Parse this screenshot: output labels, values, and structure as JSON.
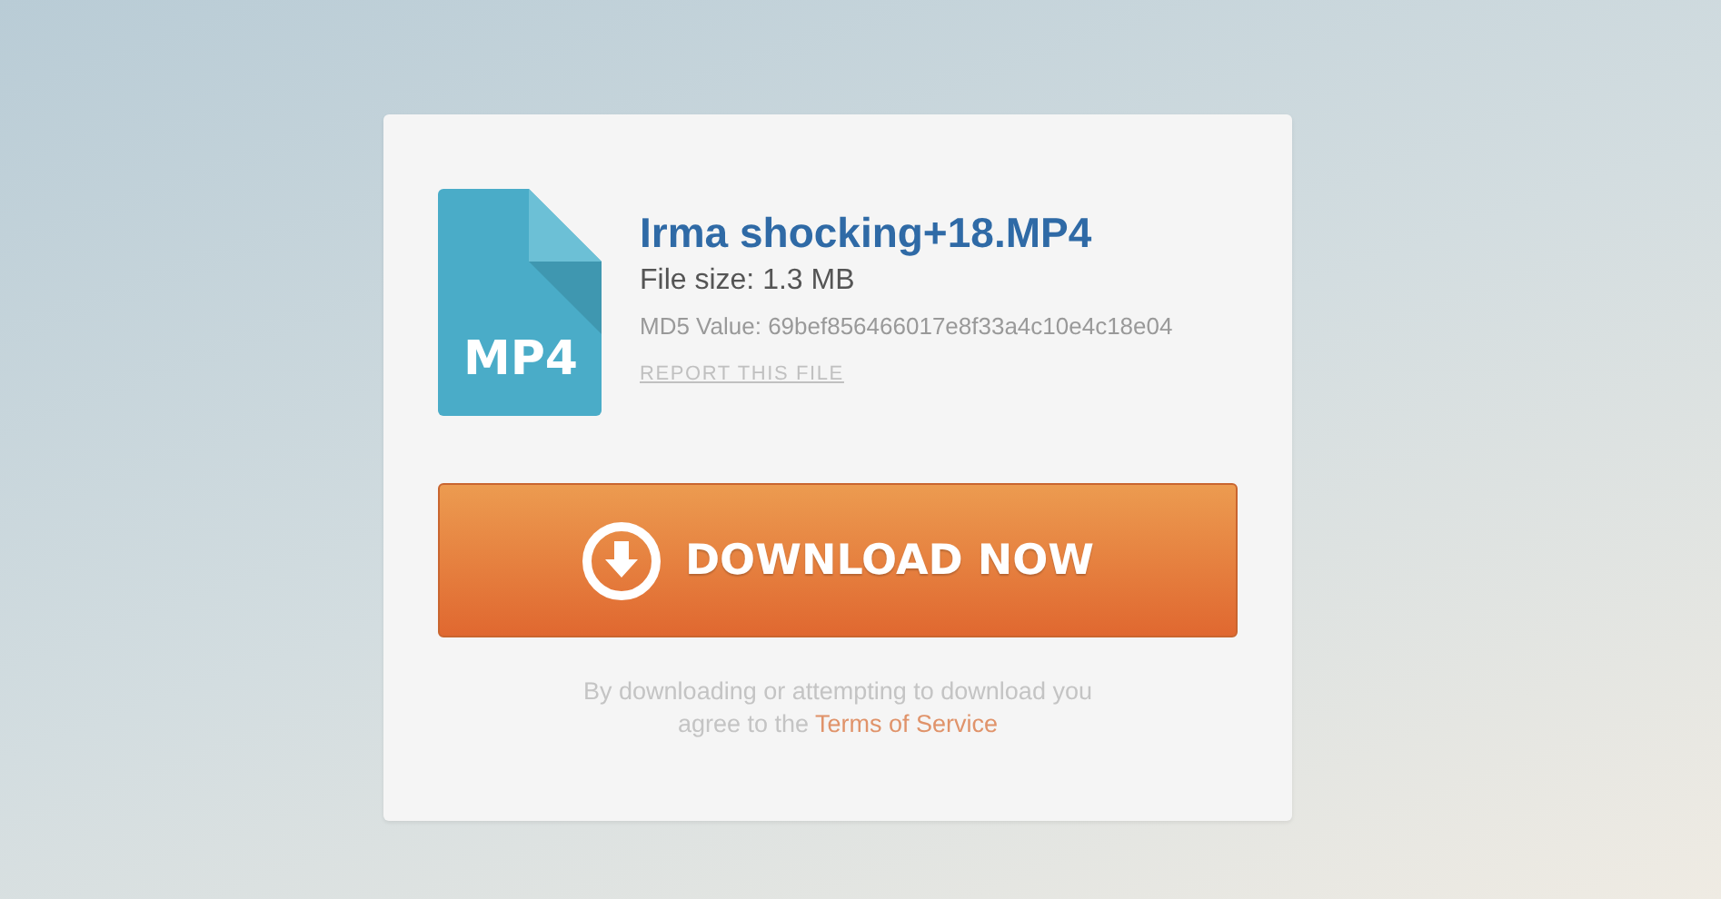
{
  "file": {
    "type_label": "MP4",
    "name": "Irma shocking+18.MP4",
    "size": "File size: 1.3 MB",
    "md5": "MD5 Value: 69bef856466017e8f33a4c10e4c18e04",
    "report_link": "REPORT THIS FILE"
  },
  "download_button": {
    "label": "DOWNLOAD NOW"
  },
  "terms": {
    "text": "By downloading or attempting to download you agree to the",
    "link": "Terms of Service"
  }
}
